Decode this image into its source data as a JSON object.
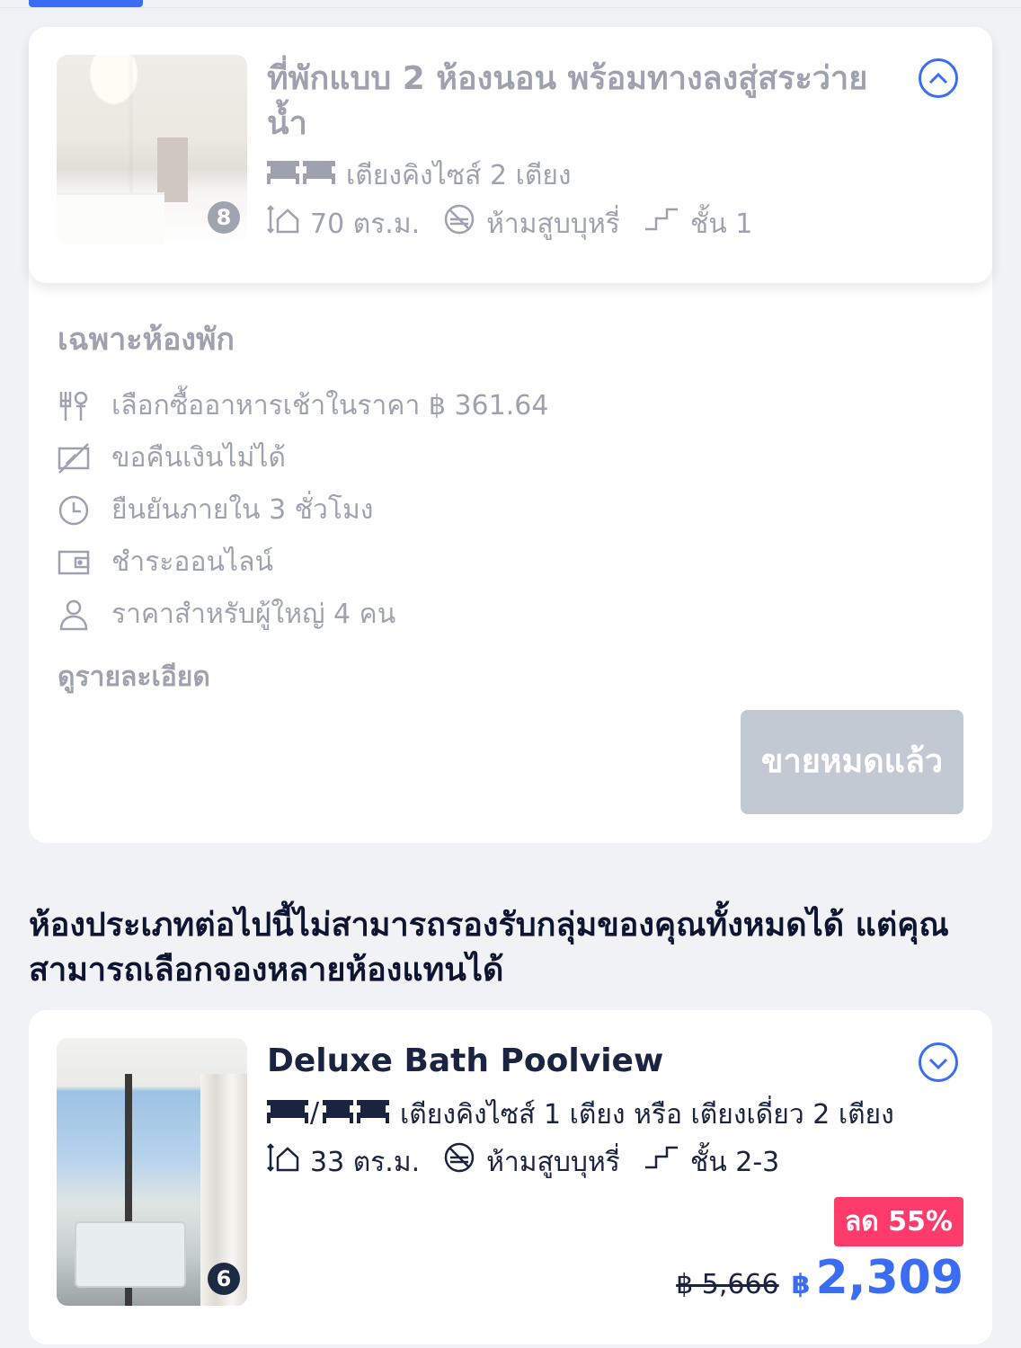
{
  "room1": {
    "photo_count": "8",
    "title": "ที่พักแบบ 2 ห้องนอน พร้อมทางลงสู่สระว่ายน้ำ",
    "beds": "เตียงคิงไซส์ 2 เตียง",
    "size": "70 ตร.ม.",
    "smoking": "ห้ามสูบบุหรี่",
    "floor": "ชั้น 1",
    "expanded": true
  },
  "offer": {
    "title": "เฉพาะห้องพัก",
    "features": [
      {
        "icon": "utensils-icon",
        "text": "เลือกซื้ออาหารเช้าในราคา ฿ 361.64"
      },
      {
        "icon": "no-refund-icon",
        "text": "ขอคืนเงินไม่ได้"
      },
      {
        "icon": "clock-icon",
        "text": "ยืนยันภายใน 3 ชั่วโมง"
      },
      {
        "icon": "wallet-icon",
        "text": "ชำระออนไลน์"
      },
      {
        "icon": "person-icon",
        "text": "ราคาสำหรับผู้ใหญ่ 4 คน"
      }
    ],
    "details_link": "ดูรายละเอียด",
    "soldout_label": "ขายหมดแล้ว"
  },
  "notice": "ห้องประเภทต่อไปนี้ไม่สามารถรองรับกลุ่มของคุณทั้งหมดได้ แต่คุณสามารถเลือกจองหลายห้องแทนได้",
  "room2": {
    "photo_count": "6",
    "title": "Deluxe Bath Poolview",
    "beds": "เตียงคิงไซส์ 1 เตียง หรือ เตียงเดี่ยว 2 เตียง",
    "size": "33 ตร.ม.",
    "smoking": "ห้ามสูบบุหรี่",
    "floor": "ชั้น 2-3",
    "discount": "ลด 55%",
    "old_price": "฿ 5,666",
    "currency": "฿",
    "price": "2,309",
    "expanded": false
  },
  "colors": {
    "accent": "#3b6cf4",
    "discount": "#ff3b6b",
    "soldout": "#c3c9d3",
    "background": "#f0f2f6"
  }
}
